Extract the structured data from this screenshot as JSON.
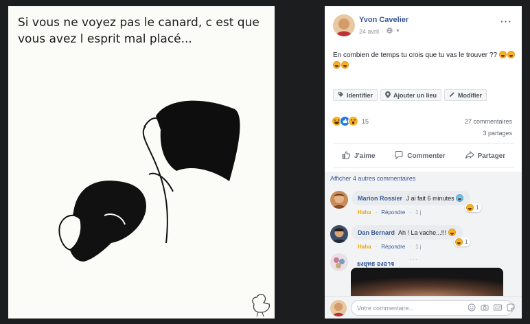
{
  "photo": {
    "caption": "Si vous ne voyez pas le canard, c est que  vous avez l esprit mal placé..."
  },
  "post": {
    "author": "Yvon Cavelier",
    "date": "24 avril",
    "text": "En combien de temps tu crois que tu vas le trouver ??",
    "tag_buttons": [
      "Identifier",
      "Ajouter un lieu",
      "Modifier"
    ],
    "reaction_count": "15",
    "comments_count": "27 commentaires",
    "shares_count": "3 partages",
    "actions": [
      "J'aime",
      "Commenter",
      "Partager"
    ]
  },
  "comments": {
    "more_label": "Afficher 4 autres commentaires",
    "items": [
      {
        "author": "Marion Rossier",
        "text": "J ai fait 6 minutes",
        "reaction": "Haha",
        "reply": "Répondre",
        "age": "1 j",
        "reaction_count": "1"
      },
      {
        "author": "Dan Bernard",
        "text": "Ah ! La vache...!!!",
        "reaction": "Haha",
        "reply": "Répondre",
        "age": "1 j",
        "reaction_count": "1"
      },
      {
        "author": "ยงยุทธ องอาจ"
      }
    ]
  },
  "composer": {
    "placeholder": "Votre commentaire..."
  },
  "colors": {
    "link": "#385898",
    "haha": "#f0a30a",
    "like": "#1877f2",
    "background": "#1c1d1f"
  }
}
